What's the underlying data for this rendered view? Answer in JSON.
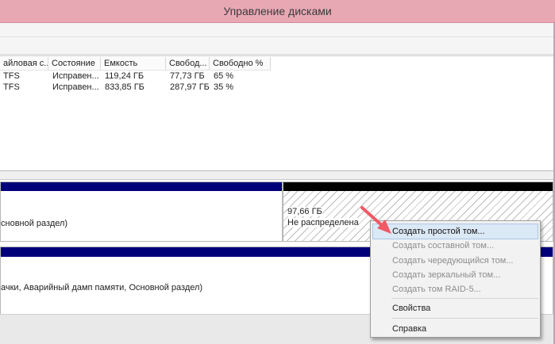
{
  "window": {
    "title": "Управление дисками"
  },
  "volume_list": {
    "columns": [
      "айловая с...",
      "Состояние",
      "Емкость",
      "Свобод...",
      "Свободно %"
    ],
    "rows": [
      [
        "TFS",
        "Исправен...",
        "119,24 ГБ",
        "77,73 ГБ",
        "65 %"
      ],
      [
        "TFS",
        "Исправен...",
        "833,85 ГБ",
        "287,97 ГБ",
        "35 %"
      ]
    ]
  },
  "disks": {
    "disk0": {
      "partition_label": "сновной раздел)"
    },
    "unallocated": {
      "size": "97,66 ГБ",
      "status": "Не распределена"
    },
    "disk1": {
      "partition_label": "ачки, Аварийный дамп памяти, Основной раздел)"
    }
  },
  "context_menu": {
    "items": [
      {
        "label": "Создать простой том...",
        "enabled": true,
        "highlighted": true
      },
      {
        "label": "Создать составной том...",
        "enabled": false
      },
      {
        "label": "Создать чередующийся том...",
        "enabled": false
      },
      {
        "label": "Создать зеркальный том...",
        "enabled": false
      },
      {
        "label": "Создать том RAID-5...",
        "enabled": false
      },
      {
        "label": "Свойства",
        "enabled": true
      },
      {
        "label": "Справка",
        "enabled": true
      }
    ]
  },
  "colors": {
    "title_bar": "#e8a8b3",
    "primary_partition_bar": "#00007b",
    "unallocated_bar": "#000000",
    "menu_highlight": "#dbe8f5",
    "annotation_arrow": "#ef5a66"
  },
  "icons": {
    "annotation": "red-arrow-icon"
  }
}
